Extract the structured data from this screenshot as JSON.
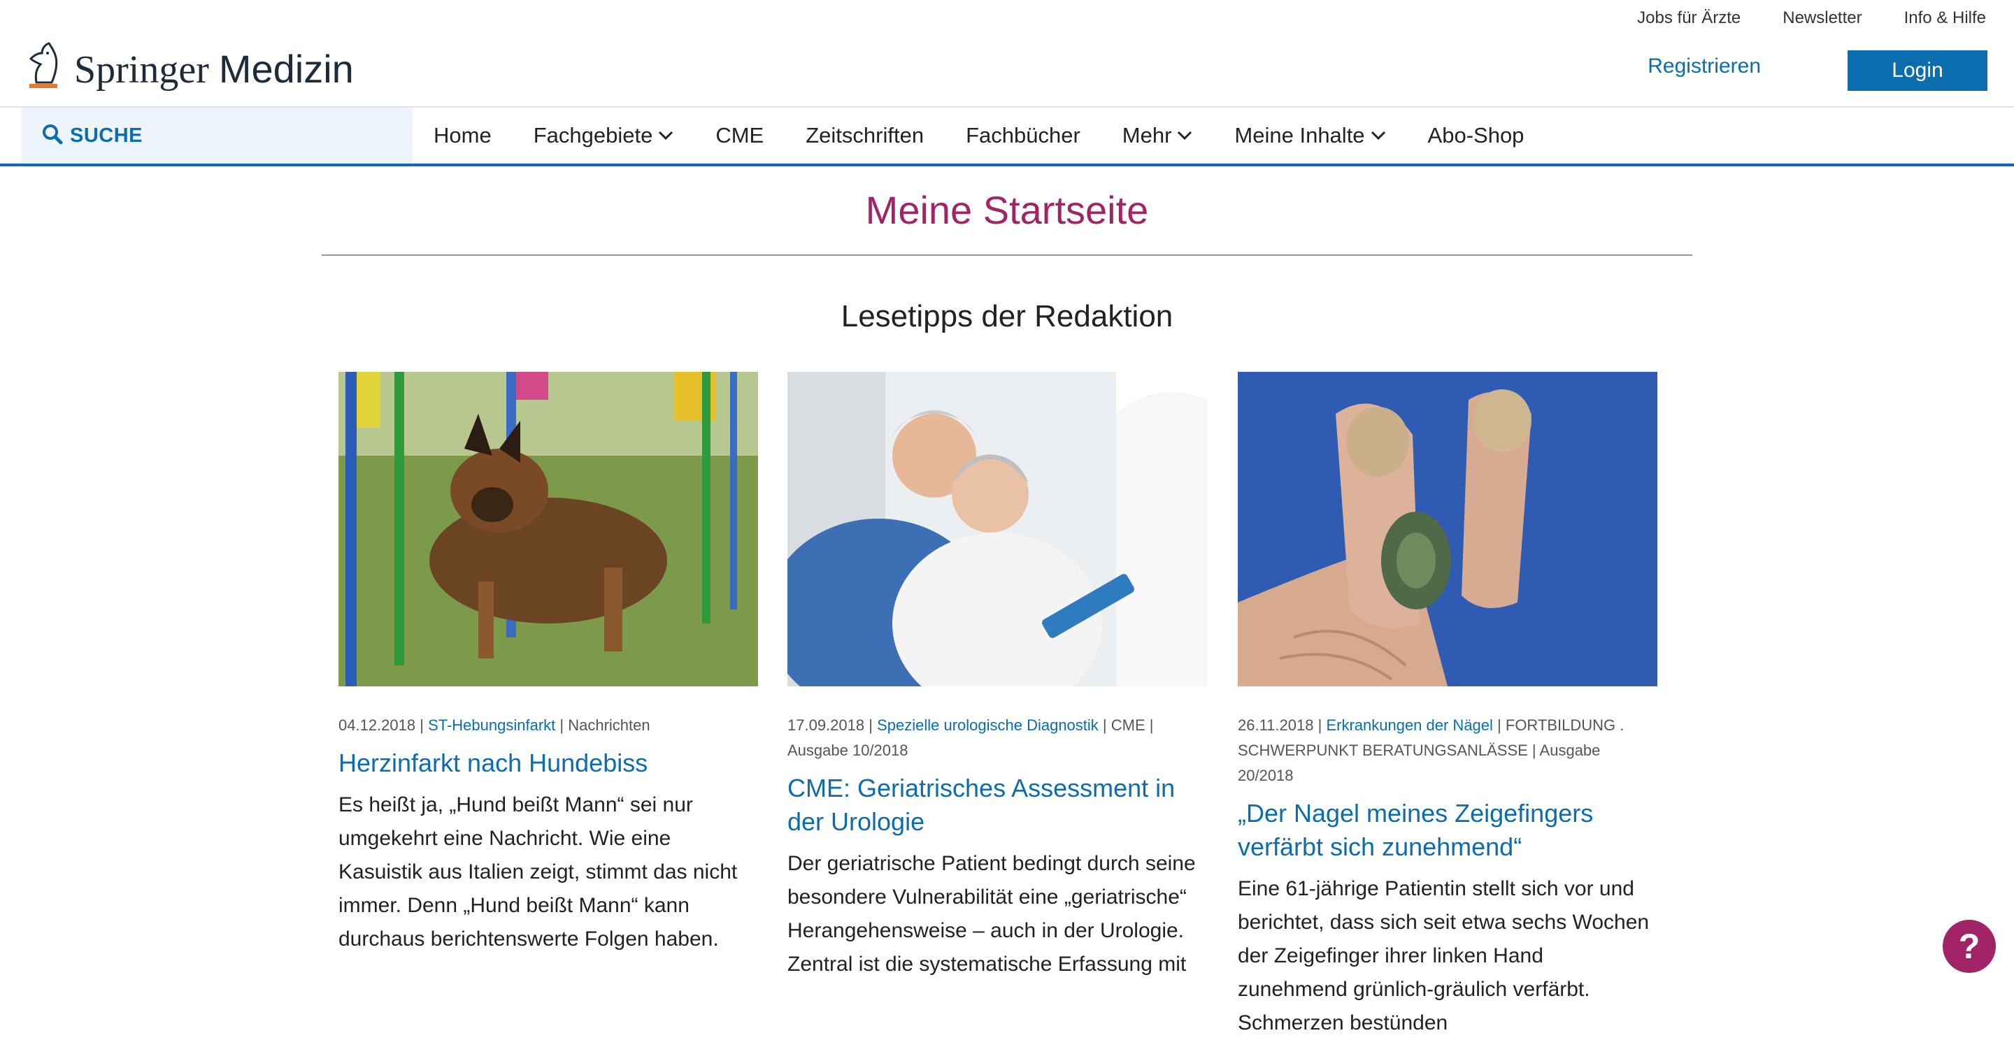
{
  "toplinks": [
    "Jobs für Ärzte",
    "Newsletter",
    "Info & Hilfe"
  ],
  "brand": {
    "name_part1": "Springer",
    "name_part2": "Medizin"
  },
  "auth": {
    "register": "Registrieren",
    "login": "Login"
  },
  "search": {
    "label": "SUCHE"
  },
  "nav": [
    "Home",
    "Fachgebiete",
    "CME",
    "Zeitschriften",
    "Fachbücher",
    "Mehr",
    "Meine Inhalte",
    "Abo-Shop"
  ],
  "page_title": "Meine Startseite",
  "section_title": "Lesetipps der Redaktion",
  "cards": [
    {
      "date": "04.12.2018",
      "tag": "ST-Hebungsinfarkt",
      "meta_rest": "| Nachrichten",
      "title": "Herzinfarkt nach Hundebiss",
      "teaser": "Es heißt ja, „Hund beißt Mann“ sei nur umgekehrt eine Nachricht. Wie eine Kasuistik aus Italien zeigt, stimmt das nicht immer. Denn „Hund beißt Mann“ kann durchaus berichtenswerte Folgen haben."
    },
    {
      "date": "17.09.2018",
      "tag": "Spezielle urologische Diagnostik",
      "meta_rest": "| CME | Ausgabe 10/2018",
      "title": "CME: Geriatrisches Assessment in der Urologie",
      "teaser": "Der geriatrische Patient bedingt durch seine besondere Vulnerabilität eine „geriatrische“ Herangehensweise – auch in der Urologie. Zentral ist die systematische Erfassung mit"
    },
    {
      "date": "26.11.2018",
      "tag": "Erkrankungen der Nägel",
      "meta_rest": "| FORTBILDUNG . SCHWERPUNKT BERATUNGSANLÄSSE | Ausgabe 20/2018",
      "title": "„Der Nagel meines Zeigefingers verfärbt sich zunehmend“",
      "teaser": "Eine 61-jährige Patientin stellt sich vor und berichtet, dass sich seit etwa sechs Wochen der Zeigefinger ihrer linken Hand zunehmend grünlich-gräulich verfärbt. Schmerzen bestünden"
    }
  ],
  "help": {
    "symbol": "?"
  }
}
